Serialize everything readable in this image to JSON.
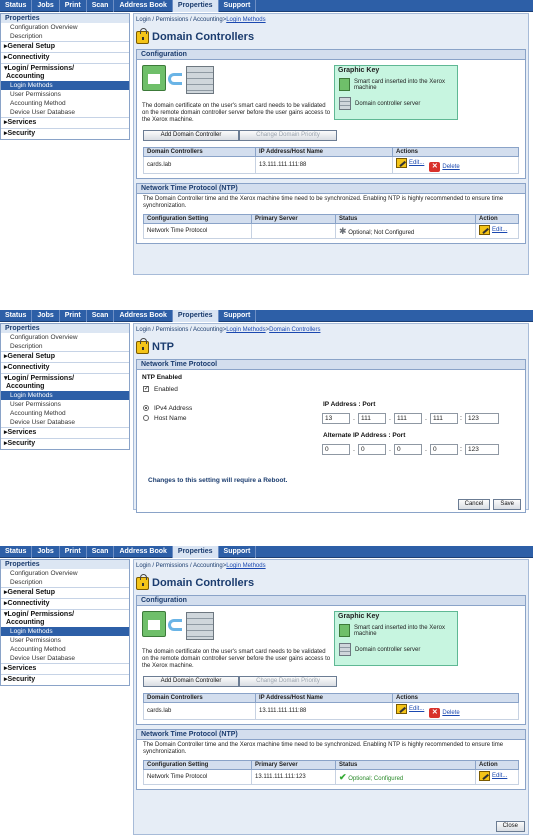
{
  "nav": {
    "tabs": [
      "Status",
      "Jobs",
      "Print",
      "Scan",
      "Address Book",
      "Properties",
      "Support"
    ],
    "active": "Properties"
  },
  "sidebar": {
    "heading": "Properties",
    "config_overview": "Configuration Overview",
    "description": "Description",
    "general_setup": "General Setup",
    "connectivity": "Connectivity",
    "login_permissions": "Login/ Permissions/",
    "accounting": "Accounting",
    "login_methods": "Login Methods",
    "user_permissions": "User Permissions",
    "accounting_method": "Accounting Method",
    "device_user_database": "Device User Database",
    "services": "Services",
    "security": "Security"
  },
  "panel1": {
    "breadcrumb_prefix": "Login / Permissions / Accounting>",
    "breadcrumb_link": "Login Methods",
    "title": "Domain Controllers",
    "configuration_heading": "Configuration",
    "config_text": "The domain certificate on the user's smart card needs to be validated on the remote domain controller server before the user gains access to the Xerox machine.",
    "graphic_key_title": "Graphic Key",
    "key_smartcard": "Smart card inserted into the Xerox machine",
    "key_dc": "Domain controller server",
    "add_button": "Add Domain Controller",
    "change_priority_button": "Change Domain Priority",
    "dc_headers": [
      "Domain Controllers",
      "IP Address/Host Name",
      "Actions"
    ],
    "dc_row": {
      "name": "cards.lab",
      "ip": "13.111.111.111:88",
      "edit": "Edit...",
      "delete": "Delete"
    },
    "ntp_heading": "Network Time Protocol (NTP)",
    "ntp_text": "The Domain Controller time and the Xerox machine time need to be synchronized. Enabling NTP is highly recommended to ensure time synchronization.",
    "ntp_headers": [
      "Configuration Setting",
      "Primary Server",
      "Status",
      "Action"
    ],
    "ntp_row": {
      "setting": "Network Time Protocol",
      "server": "",
      "status": "Optional; Not Configured",
      "edit": "Edit..."
    }
  },
  "panel2": {
    "breadcrumb_prefix": "Login / Permissions / Accounting>",
    "breadcrumb_link1": "Login Methods",
    "breadcrumb_sep": ">",
    "breadcrumb_link2": "Domain Controllers",
    "title": "NTP",
    "section_heading": "Network Time Protocol",
    "ntp_enabled_label": "NTP Enabled",
    "enabled_label": "Enabled",
    "ipv4_label": "IPv4 Address",
    "hostname_label": "Host Name",
    "ip_port_label": "IP Address : Port",
    "ip": [
      "13",
      "111",
      "111",
      "111"
    ],
    "port": "123",
    "alt_ip_port_label": "Alternate IP Address : Port",
    "alt_ip": [
      "0",
      "0",
      "0",
      "0"
    ],
    "alt_port": "123",
    "reboot_notice": "Changes to this setting will require a Reboot.",
    "cancel": "Cancel",
    "save": "Save"
  },
  "panel3": {
    "ntp_row": {
      "setting": "Network Time Protocol",
      "server": "13.111.111.111:123",
      "status": "Optional; Configured",
      "edit": "Edit..."
    },
    "close": "Close"
  }
}
